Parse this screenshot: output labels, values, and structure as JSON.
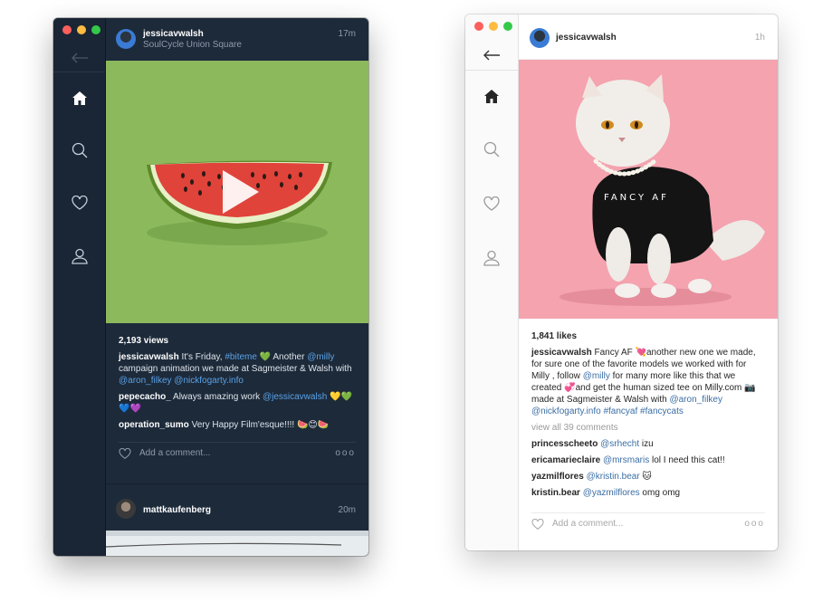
{
  "dark_window": {
    "post1": {
      "username": "jessicavwalsh",
      "location": "SoulCycle Union Square",
      "time": "17m",
      "views": "2,193 views",
      "caption_user": "jessicavwalsh",
      "caption_text_1": " It's Friday, ",
      "caption_tag_1": "#biteme",
      "caption_text_2": " 💚 Another ",
      "caption_tag_2": "@milly",
      "caption_text_3": " campaign animation we made at Sagmeister & Walsh with ",
      "caption_tag_3": "@aron_filkey",
      "caption_text_4": " ",
      "caption_tag_4": "@nickfogarty.info",
      "comments": [
        {
          "user": "pepecacho_",
          "text": " Always amazing work ",
          "tag": "@jessicavwalsh",
          "after": " 💛💚💙💜"
        },
        {
          "user": "operation_sumo",
          "text": " Very Happy Film'esque!!!! 🍉😊🍉",
          "tag": "",
          "after": ""
        }
      ],
      "comment_placeholder": "Add a comment...",
      "more": "ooo"
    },
    "post2": {
      "username": "mattkaufenberg",
      "time": "20m"
    }
  },
  "light_window": {
    "post": {
      "username": "jessicavwalsh",
      "time": "1h",
      "likes": "1,841 likes",
      "caption_user": "jessicavwalsh",
      "caption_text_1": " Fancy AF 💘another new one we made, for sure one of the favorite models we worked with for Milly , follow ",
      "caption_tag_1": "@milly",
      "caption_text_2": " for many more like this that we created 💞and get the human sized tee on Milly.com 📷 made at Sagmeister & Walsh with ",
      "caption_tag_2": "@aron_filkey",
      "caption_text_3": " ",
      "caption_tag_3": "@nickfogarty.info",
      "caption_text_4": " ",
      "caption_tag_4": "#fancyaf",
      "caption_text_5": " ",
      "caption_tag_5": "#fancycats",
      "view_all": "view all 39 comments",
      "comments": [
        {
          "user": "princesscheeto",
          "tag": "@srhecht",
          "after": " izu"
        },
        {
          "user": "ericamarieclaire",
          "tag": "@mrsmaris",
          "after": " lol I need this cat!!"
        },
        {
          "user": "yazmilflores",
          "tag": "@kristin.bear",
          "after": " 🐱"
        },
        {
          "user": "kristin.bear",
          "tag": "@yazmilflores",
          "after": " omg omg"
        }
      ],
      "comment_placeholder": "Add a comment...",
      "more": "ooo",
      "shirt_text": "FANCY AF"
    }
  },
  "colors": {
    "dark_bg": "#1d2a3a",
    "accent_link_dark": "#5aa2e6",
    "accent_link_light": "#3b6ea5",
    "watermelon_bg": "#8ab85a",
    "cat_bg": "#f2a0ac"
  },
  "icons": [
    "back-arrow-icon",
    "home-icon",
    "search-icon",
    "heart-icon",
    "user-icon",
    "play-icon",
    "more-icon"
  ]
}
